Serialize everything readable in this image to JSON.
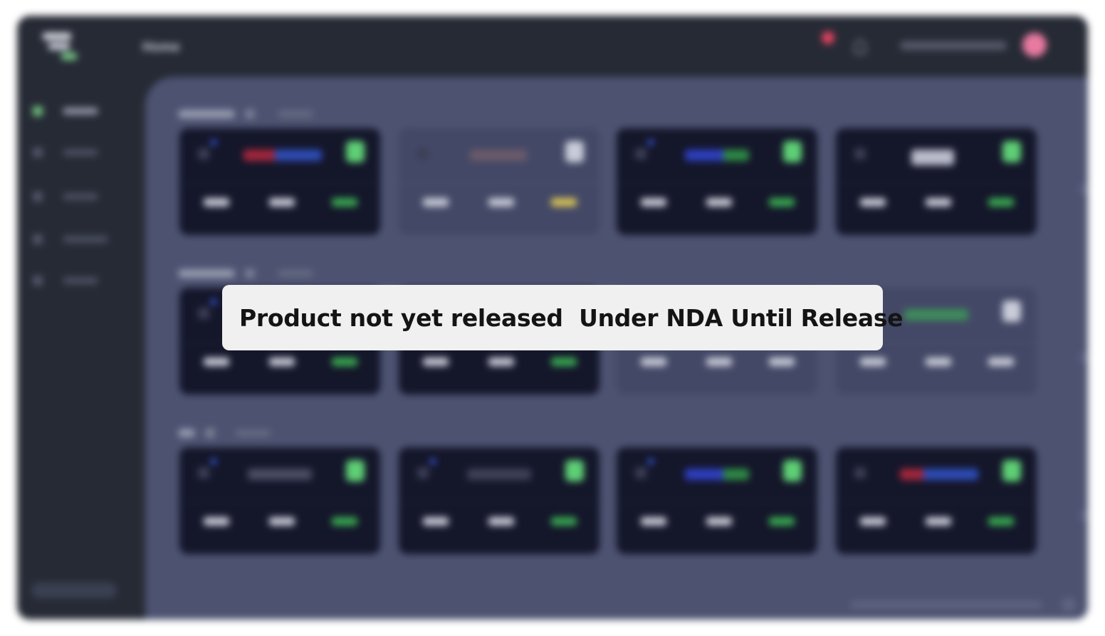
{
  "app": {
    "page_title": "Home",
    "notification_color": "#e2435f"
  },
  "sidebar": {
    "items": [
      {
        "name": "home",
        "active": true
      },
      {
        "name": "item-2",
        "active": false
      },
      {
        "name": "item-3",
        "active": false
      },
      {
        "name": "item-4",
        "active": false
      },
      {
        "name": "item-5",
        "active": false
      }
    ]
  },
  "sections": [
    {
      "cards": [
        "dark",
        "light",
        "dark",
        "dark"
      ]
    },
    {
      "cards": [
        "dark",
        "dark",
        "light",
        "light"
      ]
    },
    {
      "cards": [
        "dark",
        "dark",
        "dark",
        "dark"
      ]
    }
  ],
  "colors": {
    "accent_green": "#5ecf75",
    "brand_blue": "#3f66ff",
    "panel_bg": "#4c5270",
    "card_bg": "#14162a"
  },
  "overlay": {
    "text": "Product not yet released  Under NDA Until Release"
  }
}
